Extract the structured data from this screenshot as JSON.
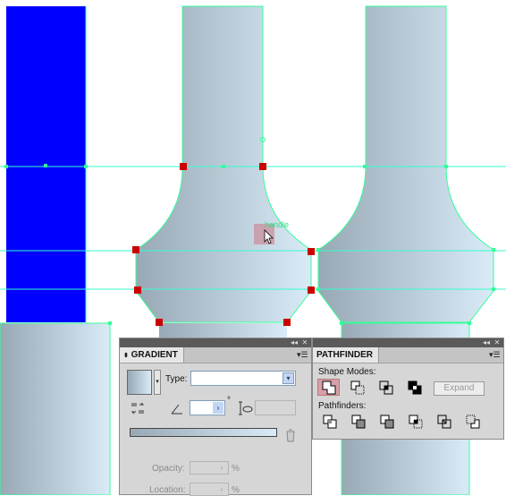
{
  "canvas": {
    "smart_guide_label": "handle",
    "colors": {
      "blue_fill": "#0000ff",
      "guide": "#33ff99",
      "anchor": "#cc0000",
      "gradient_light": "#d8ebf7",
      "gradient_dark": "#98a8b5"
    }
  },
  "gradient_panel": {
    "tab_label": "GRADIENT",
    "type_label": "Type:",
    "type_value": "",
    "angle_value": "",
    "degree_symbol": "°",
    "aspect_value": "",
    "opacity_label": "Opacity:",
    "opacity_value": "",
    "opacity_unit": "%",
    "location_label": "Location:",
    "location_value": "",
    "location_unit": "%"
  },
  "pathfinder_panel": {
    "tab_label": "PATHFINDER",
    "shape_modes_label": "Shape Modes:",
    "expand_label": "Expand",
    "pathfinders_label": "Pathfinders:",
    "shape_mode_icons": [
      "unite-icon",
      "minus-front-icon",
      "intersect-icon",
      "exclude-icon"
    ],
    "pathfinder_icons": [
      "divide-icon",
      "trim-icon",
      "merge-icon",
      "crop-icon",
      "outline-icon",
      "minus-back-icon"
    ]
  },
  "panel_controls": {
    "collapse_glyph": "◂◂",
    "close_glyph": "✕",
    "menu_glyph": "▾☰"
  }
}
